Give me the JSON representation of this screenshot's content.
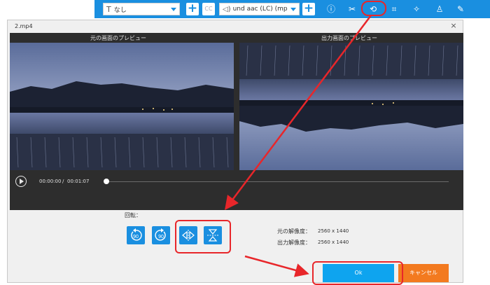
{
  "toolbar": {
    "subtitle_select": "なし",
    "audio_select": "und aac (LC) (mp",
    "cc_label": "CC",
    "icons": [
      "info-icon",
      "cut-icon",
      "rotate-icon",
      "crop-icon",
      "effects-icon",
      "watermark-icon",
      "edit-icon"
    ]
  },
  "dialog": {
    "title": "2.mp4",
    "close": "×",
    "original_preview_label": "元の画面のプレビュー",
    "output_preview_label": "出力画面のプレビュー",
    "time_current": "00:00:00",
    "time_separator": "/",
    "time_total": "00:01:07",
    "rotate_label": "回転：",
    "rotate_left_text": "90",
    "rotate_right_text": "90",
    "original_resolution_label": "元の解像度：",
    "original_resolution_value": "2560 x 1440",
    "output_resolution_label": "出力解像度：",
    "output_resolution_value": "2560 x 1440",
    "ok_label": "Ok",
    "cancel_label": "キャンセル"
  },
  "colors": {
    "toolbar_blue": "#1a8fe0",
    "ok_blue": "#0ea4ef",
    "cancel_orange": "#f37a1f",
    "annotation_red": "#e8262a"
  }
}
